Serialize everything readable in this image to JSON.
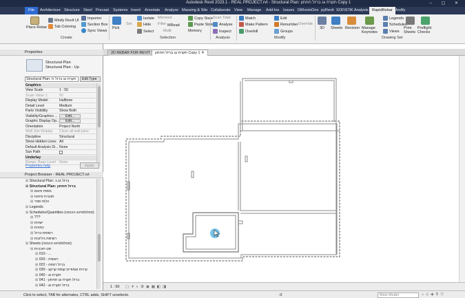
{
  "app": {
    "title": "Autodesk Revit 2023.1 - REAL PROJECT.rvt - Structural Plan: תקרת גג ברזל תחתון Copy 1",
    "window_buttons": "–  ▢  ✕"
  },
  "ribbon_tabs": [
    "File",
    "Architecture",
    "Structure",
    "Steel",
    "Precast",
    "Systems",
    "Insert",
    "Annotate",
    "Analyze",
    "Massing & Site",
    "Collaborate",
    "View",
    "Manage",
    "Add-Ins",
    "Issues",
    "DiRootsOne",
    "pyRevit",
    "SOFiSTiK Analysis",
    "RapidRebar",
    "Modify"
  ],
  "active_tab": "RapidRebar",
  "ribbon": {
    "place_rebar": "Place Rebar",
    "minify": "Minify Revit UI",
    "tab_coloring": "Tab Coloring",
    "importer": "Importer",
    "section_box": "Section Box",
    "sync_views": "Sync Views",
    "pick": "Pick",
    "isolate": "Isolate",
    "hide": "Hide",
    "select": "Select",
    "set": "Set",
    "filter": "Filter",
    "mirrored": "Mirrored",
    "multi": "Multi",
    "mread": "MRead",
    "memory": "Memory",
    "copy_state": "Copy State",
    "paste_state": "Paste State",
    "scan_total": "Scan Total",
    "analyse": "Analyse",
    "inspect": "Inspect",
    "match": "Match",
    "make_pattern": "Make Pattern",
    "overkill": "Overkill",
    "edit": "Edit",
    "renumber": "Renumber",
    "groups": "Groups",
    "override": "Override",
    "sheets": "Sheets",
    "revision": "Revision",
    "manage_keynotes": "Manage Keynotes",
    "legends": "Legends",
    "schedules": "Schedules",
    "views": "Views",
    "print_sheets": "Print Sheets",
    "preflight_checks": "Preflight Checks",
    "three_d": "3D",
    "group_create": "Create",
    "group_selection": "Selection",
    "group_analysis": "Analysis",
    "group_modify": "Modify",
    "group_drawing_set": "Drawing Set"
  },
  "properties": {
    "header": "Properties",
    "type_line1": "Structural Plan",
    "type_line2": "Structural Plan - Up",
    "selector": "Structural Plan: תקרת גג ברזל ת",
    "edit_type": "Edit Type",
    "section_graphics": "Graphics",
    "rows": [
      {
        "k": "View Scale",
        "v": "1 : 50",
        "dim": false
      },
      {
        "k": "Scale Value 1:",
        "v": "50",
        "dim": true
      },
      {
        "k": "Display Model",
        "v": "Halftone",
        "dim": false
      },
      {
        "k": "Detail Level",
        "v": "Medium",
        "dim": false
      },
      {
        "k": "Parts Visibility",
        "v": "Show Both",
        "dim": false
      },
      {
        "k": "Visibility/Graphics ...",
        "v": "Edit...",
        "dim": false
      },
      {
        "k": "Graphic Display Op...",
        "v": "Edit...",
        "dim": false
      },
      {
        "k": "Orientation",
        "v": "Project North",
        "dim": false
      },
      {
        "k": "Wall Join Display",
        "v": "Clean all wall joins",
        "dim": true
      },
      {
        "k": "Discipline",
        "v": "Structural",
        "dim": false
      },
      {
        "k": "Show Hidden Lines",
        "v": "All",
        "dim": false
      },
      {
        "k": "Default Analysis Di...",
        "v": "None",
        "dim": false
      },
      {
        "k": "Sun Path",
        "v": "",
        "dim": false
      }
    ],
    "section_underlay": "Underlay",
    "range_label": "Range: Base Level",
    "range_value": "None",
    "help": "Properties help",
    "apply": "Apply"
  },
  "browser": {
    "header": "Project Browser - REAL PROJECT.rvt",
    "items": [
      {
        "t": "Structural Plan: ברזל גג ב",
        "indent": 0,
        "bold": false
      },
      {
        "t": "Structural Plan: ברזל תחתון",
        "indent": 0,
        "bold": true
      },
      {
        "t": "נספח פיגום",
        "indent": 1,
        "bold": false
      },
      {
        "t": "תוכנית פיתוח",
        "indent": 1,
        "bold": false
      },
      {
        "t": "הלוח ספר",
        "indent": 1,
        "bold": false
      },
      {
        "t": "Legends",
        "indent": 0,
        "bold": false
      },
      {
        "t": "Schedules/Quantities (מפלס/סיווג הכנסה)",
        "indent": 0,
        "bold": false
      },
      {
        "t": "???",
        "indent": 1,
        "bold": false
      },
      {
        "t": "ישויות",
        "indent": 1,
        "bold": false
      },
      {
        "t": "כמויות",
        "indent": 1,
        "bold": false
      },
      {
        "t": "רשימת ברזל",
        "indent": 1,
        "bold": false
      },
      {
        "t": "רשימת גיליונות",
        "indent": 1,
        "bold": false
      },
      {
        "t": "Sheets (מפלס/סיווג הכנסה)",
        "indent": 0,
        "bold": false
      },
      {
        "t": "סט תוכניות",
        "indent": 1,
        "bold": false
      },
      {
        "t": "010 - ...",
        "indent": 2,
        "bold": false
      },
      {
        "t": "020 - ראשית",
        "indent": 2,
        "bold": false
      },
      {
        "t": "022 - ברזל רצפה",
        "indent": 2,
        "bold": false
      },
      {
        "t": "030 - קירות ועמודים קומת קרקע",
        "indent": 2,
        "bold": false
      },
      {
        "t": "040 - תקרת גג",
        "indent": 2,
        "bold": false
      },
      {
        "t": "041 - ברזל תקרת גג תחתון",
        "indent": 2,
        "bold": false
      },
      {
        "t": "042 - ברזל תקרת גג",
        "indent": 2,
        "bold": false
      }
    ]
  },
  "view_tabs": [
    {
      "label": "2D REBAR FOR REVIT",
      "active": false
    },
    {
      "label": "תקרת גג ברזל תחתון Copy 1",
      "active": true
    }
  ],
  "view_bar": {
    "scale": "1 : 50"
  },
  "status": {
    "hint": "Click to select, TAB for alternates, CTRL adds, SHIFT unselects.",
    "model": "Main Model",
    "zero": ":0"
  },
  "colors": {
    "titlebar": "#1f2a44",
    "tabbar": "#2b3856",
    "file_tab": "#2f6bd3",
    "cursor": "#5fb8e6",
    "wall": "#8a8a8a"
  }
}
